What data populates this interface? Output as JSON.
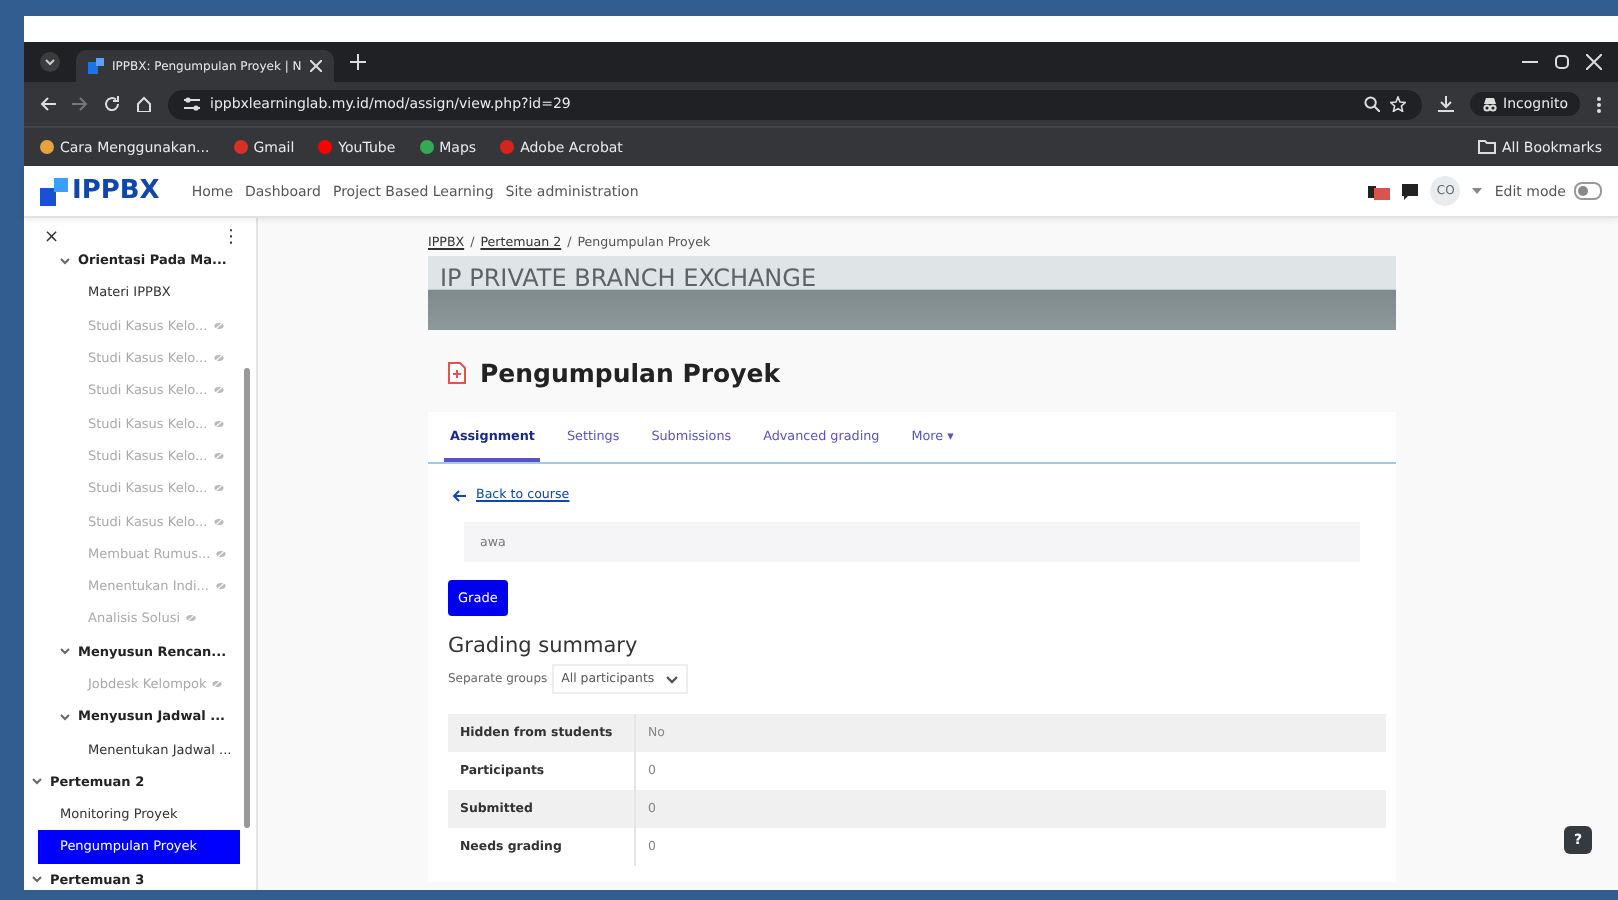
{
  "browser": {
    "tab_title": "IPPBX: Pengumpulan Proyek | N",
    "url": "ippbxlearninglab.my.id/mod/assign/view.php?id=29",
    "incognito_label": "Incognito",
    "bookmarks": [
      {
        "label": "Cara Menggunakan...",
        "color": "#e8a23a"
      },
      {
        "label": "Gmail",
        "color": "#d93025"
      },
      {
        "label": "YouTube",
        "color": "#ff0000"
      },
      {
        "label": "Maps",
        "color": "#34a853"
      },
      {
        "label": "Adobe Acrobat",
        "color": "#d6241d"
      }
    ],
    "all_bookmarks": "All Bookmarks"
  },
  "site_nav": {
    "logo": "IPPBX",
    "links": [
      {
        "label": "Home",
        "selected": false
      },
      {
        "label": "Dashboard",
        "selected": false
      },
      {
        "label": "Project Based Learning",
        "selected": false
      },
      {
        "label": "Site administration",
        "selected": false
      }
    ],
    "avatar": "CO",
    "edit_mode": {
      "label": "Edit mode",
      "on": false
    }
  },
  "sidebar": {
    "close": "×",
    "menu": "⋮",
    "items": [
      {
        "label": "Orientasi Pada Ma...",
        "kind": "subsection",
        "expanded": true,
        "selected": false,
        "children": [
          {
            "label": "Materi IPPBX",
            "hidden": false,
            "selected": false
          },
          {
            "label": "Studi Kasus Kelo...",
            "hidden": true,
            "selected": false
          },
          {
            "label": "Studi Kasus Kelo...",
            "hidden": true,
            "selected": false
          },
          {
            "label": "Studi Kasus Kelo...",
            "hidden": true,
            "selected": false
          },
          {
            "label": "Studi Kasus Kelo...",
            "hidden": true,
            "selected": false
          },
          {
            "label": "Studi Kasus Kelo...",
            "hidden": true,
            "selected": false
          },
          {
            "label": "Studi Kasus Kelo...",
            "hidden": true,
            "selected": false
          },
          {
            "label": "Studi Kasus Kelo...",
            "hidden": true,
            "selected": false
          },
          {
            "label": "Membuat Rumus...",
            "hidden": true,
            "selected": false
          },
          {
            "label": "Menentukan Indi...",
            "hidden": true,
            "selected": false
          },
          {
            "label": "Analisis Solusi",
            "hidden": true,
            "selected": false
          }
        ]
      },
      {
        "label": "Menyusun Rencan...",
        "kind": "subsection",
        "expanded": true,
        "selected": false,
        "children": [
          {
            "label": "Jobdesk Kelompok",
            "hidden": true,
            "selected": false
          }
        ]
      },
      {
        "label": "Menyusun Jadwal ...",
        "kind": "subsection",
        "expanded": true,
        "selected": false,
        "children": [
          {
            "label": "Menentukan Jadwal ...",
            "hidden": false,
            "selected": false
          }
        ]
      },
      {
        "label": "Pertemuan 2",
        "kind": "section",
        "expanded": true,
        "selected": false,
        "children": [
          {
            "label": "Monitoring Proyek",
            "hidden": false,
            "selected": false
          },
          {
            "label": "Pengumpulan Proyek",
            "hidden": false,
            "selected": true
          }
        ]
      },
      {
        "label": "Pertemuan 3",
        "kind": "section",
        "expanded": true,
        "selected": false
      }
    ]
  },
  "breadcrumb": {
    "separator": "/",
    "items": [
      {
        "label": "IPPBX",
        "link": true
      },
      {
        "label": "Pertemuan 2",
        "link": true
      },
      {
        "label": "Pengumpulan Proyek",
        "link": false
      }
    ]
  },
  "banner": {
    "title": "IP PRIVATE BRANCH EXCHANGE"
  },
  "page_title": "Pengumpulan Proyek",
  "tabs": [
    {
      "label": "Assignment",
      "selected": true
    },
    {
      "label": "Settings",
      "selected": false
    },
    {
      "label": "Submissions",
      "selected": false
    },
    {
      "label": "Advanced grading",
      "selected": false
    },
    {
      "label": "More ▾",
      "selected": false
    }
  ],
  "back_link": "Back to course",
  "description": "awa",
  "grade_button": "Grade",
  "grading_summary": {
    "heading": "Grading summary",
    "group_label": "Separate groups",
    "group_select": "All participants",
    "rows": [
      {
        "label": "Hidden from students",
        "value": "No"
      },
      {
        "label": "Participants",
        "value": "0"
      },
      {
        "label": "Submitted",
        "value": "0"
      },
      {
        "label": "Needs grading",
        "value": "0"
      }
    ]
  },
  "help_button": "?"
}
